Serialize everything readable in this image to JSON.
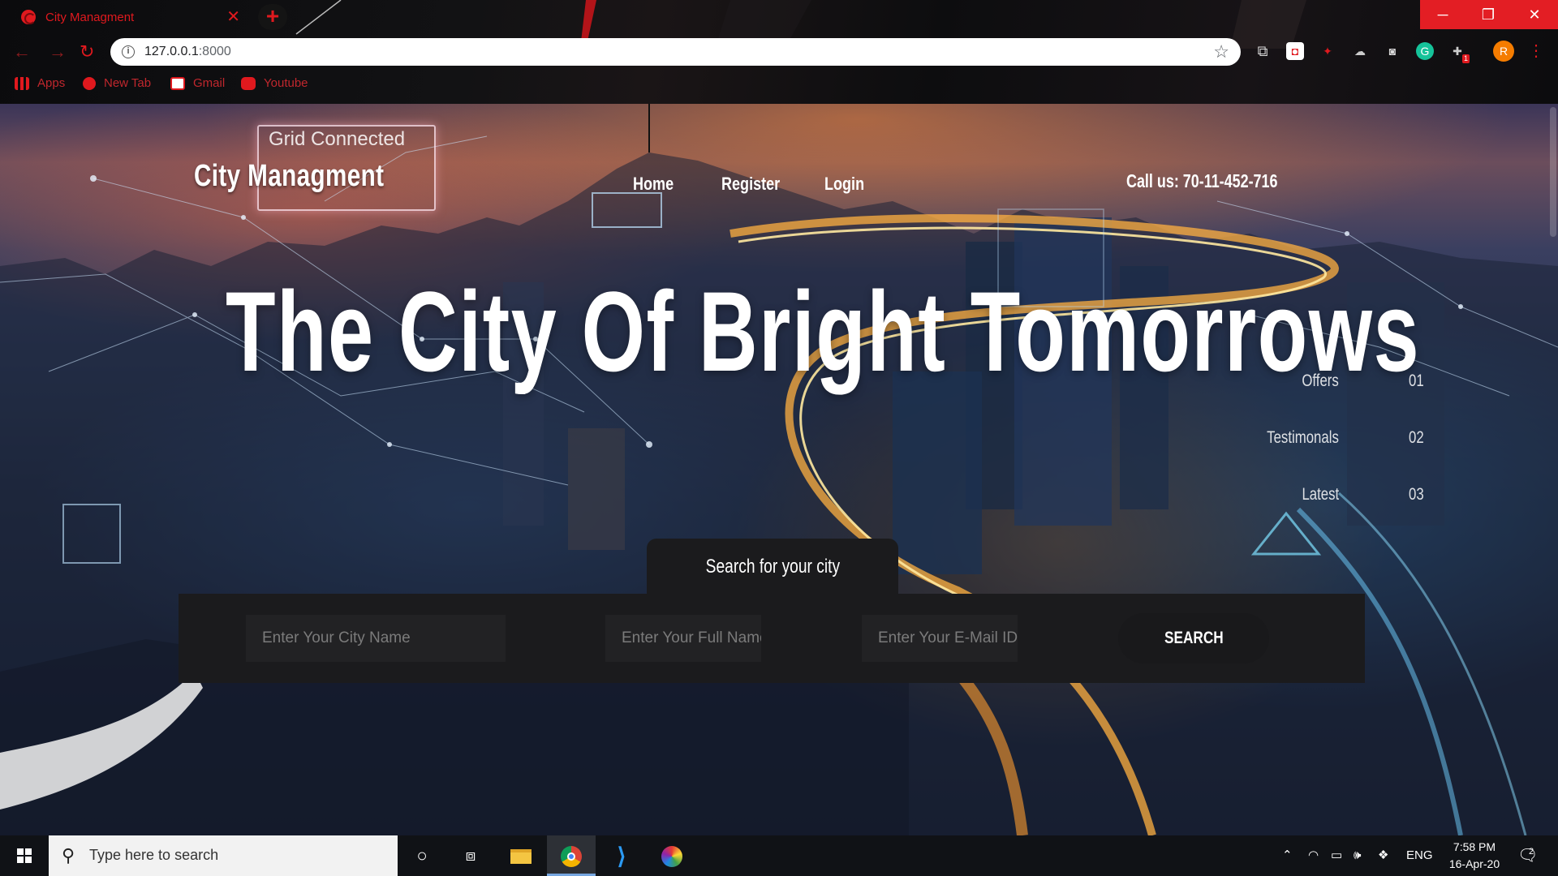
{
  "browser": {
    "tab_title": "City Managment",
    "tab_close": "✕",
    "new_tab": "+",
    "url_host": "127.0.0.1",
    "url_port": ":8000",
    "window_controls": {
      "minimize": "─",
      "restore": "❐",
      "close": "✕"
    },
    "bookmarks": [
      {
        "label": "Apps",
        "icon": "apps-grid-icon"
      },
      {
        "label": "New Tab",
        "icon": "opera-icon"
      },
      {
        "label": "Gmail",
        "icon": "gmail-icon"
      },
      {
        "label": "Youtube",
        "icon": "youtube-icon"
      }
    ],
    "profile_initial": "R",
    "extension_badge": "1"
  },
  "site": {
    "brand": "City Managment",
    "bg_overlay_label": "Grid Connected",
    "nav": [
      "Home",
      "Register",
      "Login"
    ],
    "phone": "Call us: 70-11-452-716",
    "hero_title": "The City Of Bright Tomorrows",
    "side_list": [
      {
        "label": "Offers",
        "num": "01"
      },
      {
        "label": "Testimonals",
        "num": "02"
      },
      {
        "label": "Latest",
        "num": "03"
      }
    ],
    "search_tab": "Search for your city",
    "fields": {
      "city_placeholder": "Enter Your City Name",
      "name_placeholder": "Enter Your Full Name",
      "email_placeholder": "Enter Your E-Mail ID"
    },
    "search_button": "SEARCH"
  },
  "taskbar": {
    "search_placeholder": "Type here to search",
    "language": "ENG",
    "time": "7:58 PM",
    "date": "16-Apr-20",
    "notification_count": "2"
  },
  "colors": {
    "accent_red": "#e0191e",
    "panel": "#1b1b1d",
    "taskbar": "#101216"
  }
}
